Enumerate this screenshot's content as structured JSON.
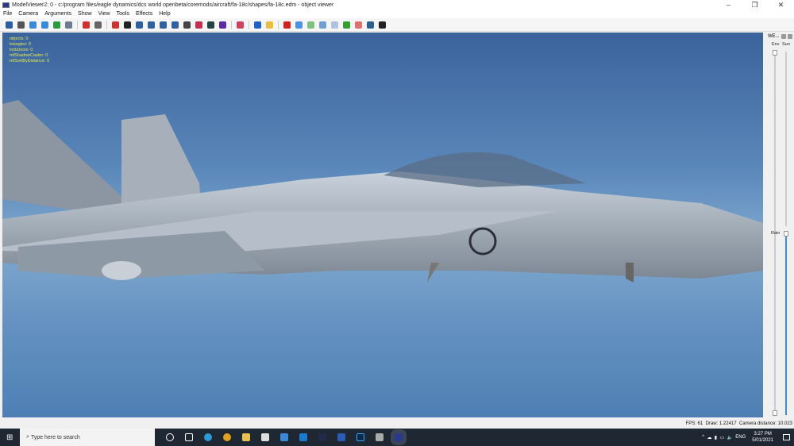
{
  "window": {
    "title": "ModelViewer2: 0 - c:/program files/eagle dynamics/dcs world openbeta/coremods/aircraft/fa-18c/shapes/fa-18c.edm - object viewer",
    "minimize": "–",
    "restore": "❐",
    "close": "✕"
  },
  "menu": [
    "File",
    "Camera",
    "Arguments",
    "Show",
    "View",
    "Tools",
    "Effects",
    "Help"
  ],
  "toolbar_colors": [
    "#2d5fa0",
    "#555",
    "#3a8ad8",
    "#3a8ad8",
    "#2a9a3a",
    "#6d7c90",
    "#d03030",
    "#666",
    "#d03030",
    "#222",
    "#3060a0",
    "#3060a0",
    "#3060a0",
    "#3060a0",
    "#444",
    "#c03050",
    "#244",
    "#5a2aa0",
    "#d04060",
    "#2060c0",
    "#e8c040",
    "#d02020",
    "#5090e0",
    "#80c080",
    "#70a0d0",
    "#b0c0e0",
    "#30a030",
    "#e07070",
    "#306090",
    "#222"
  ],
  "stats": [
    "objects: 0",
    "triangles: 0",
    "instances: 0",
    "mfShadowCaster: 0",
    "mfSortByDistance: 0"
  ],
  "weather_panel": {
    "title": "WE...",
    "sliders": [
      {
        "label": "Env",
        "value": 0
      },
      {
        "label": "Sun",
        "value": 0
      },
      {
        "label": "Rain",
        "value": 0
      }
    ]
  },
  "status": {
    "fps": "FPS: 61",
    "draw": "Draw: 1.22417",
    "camera": "Camera distance: 10.023"
  },
  "taskbar": {
    "search_placeholder": "Type here to search",
    "lang": "ENG",
    "time": "3:27 PM",
    "date": "5/01/2021"
  }
}
